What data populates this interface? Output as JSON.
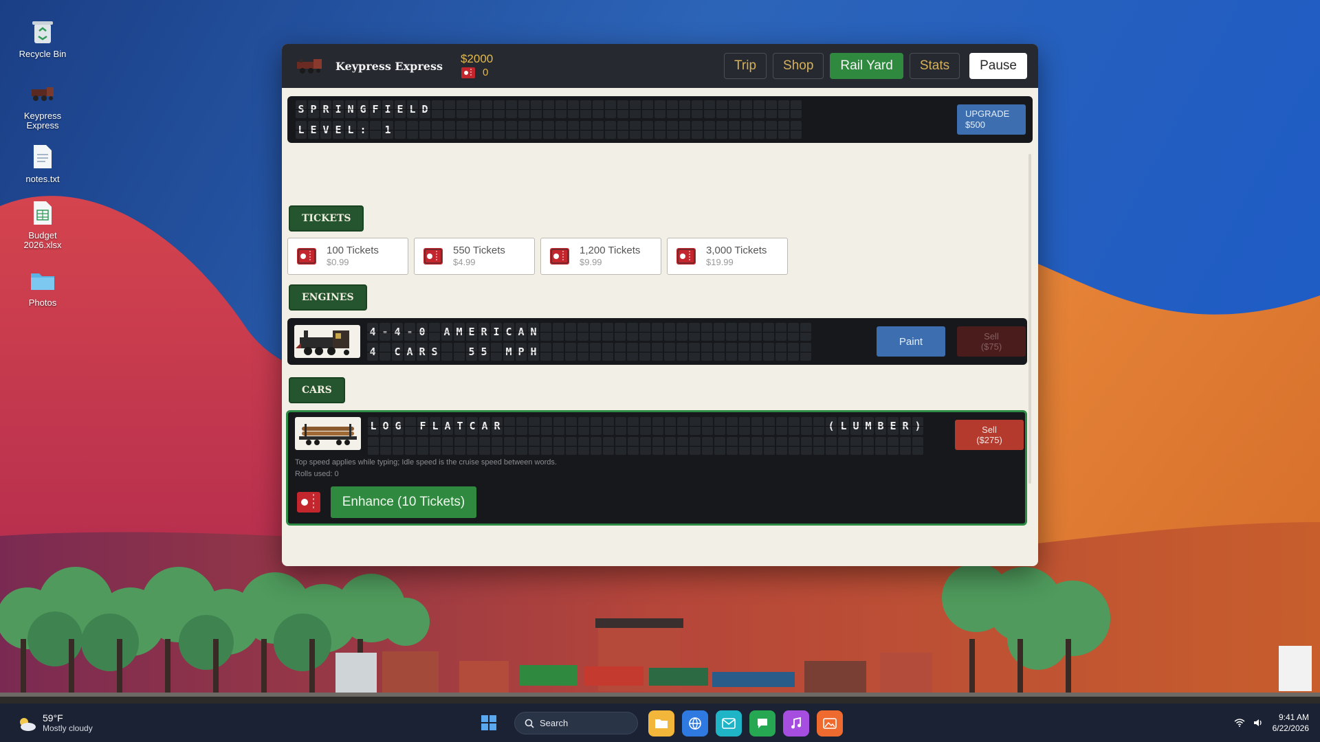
{
  "desktop": {
    "icons": [
      {
        "label": "Recycle Bin",
        "icon": "recycle-bin-icon"
      },
      {
        "label": "Keypress Express",
        "icon": "train-icon"
      },
      {
        "label": "notes.txt",
        "icon": "text-file-icon"
      },
      {
        "label": "Budget 2026.xlsx",
        "icon": "spreadsheet-icon"
      },
      {
        "label": "Photos",
        "icon": "folder-icon"
      }
    ]
  },
  "app": {
    "title": "Keypress Express",
    "money": "$2000",
    "tickets": "0",
    "nav": {
      "trip": "Trip",
      "shop": "Shop",
      "rail_yard": "Rail Yard",
      "stats": "Stats",
      "pause": "Pause"
    },
    "active_tab": "Rail Yard",
    "station": {
      "line1": "SPRINGFIELD",
      "line2": "LEVEL: 1",
      "upgrade_label": "UPGRADE",
      "upgrade_price": "$500"
    },
    "sections": {
      "tickets": "TICKETS",
      "engines": "ENGINES",
      "cars": "CARS"
    },
    "ticket_packs": [
      {
        "name": "100 Tickets",
        "price": "$0.99"
      },
      {
        "name": "550 Tickets",
        "price": "$4.99"
      },
      {
        "name": "1,200 Tickets",
        "price": "$9.99"
      },
      {
        "name": "3,000 Tickets",
        "price": "$19.99"
      }
    ],
    "engine": {
      "line1": "4-4-0 AMERICAN",
      "line2": "4 CARS  55 MPH",
      "paint_label": "Paint",
      "sell_label": "Sell",
      "sell_price": "($75)"
    },
    "car": {
      "name": "LOG FLATCAR",
      "cargo": "(LUMBER)",
      "sell_label": "Sell",
      "sell_price": "($275)",
      "note": "Top speed applies while typing; Idle speed is the cruise speed between words.",
      "rolls": "Rolls used: 0",
      "enhance_label": "Enhance (10 Tickets)"
    }
  },
  "taskbar": {
    "weather_temp": "59°F",
    "weather_cond": "Mostly cloudy",
    "search_label": "Search",
    "apps": [
      "file-explorer-icon",
      "browser-icon",
      "mail-icon",
      "chat-icon",
      "music-icon",
      "photos-icon"
    ],
    "time": "9:41 AM",
    "date": "6/22/2026"
  },
  "colors": {
    "accent_green": "#2f8a3f",
    "accent_blue": "#3d6fb0",
    "sell_red": "#b53a2e",
    "money_gold": "#e4b949",
    "topbar_bg": "#262a30"
  }
}
